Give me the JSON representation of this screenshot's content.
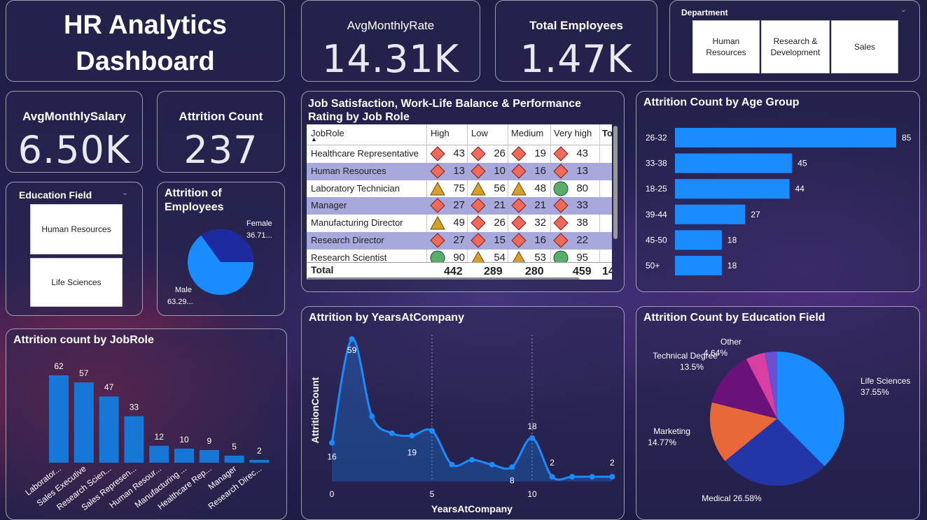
{
  "title": {
    "line1": "HR Analytics",
    "line2": "Dashboard"
  },
  "kpis": {
    "avg_monthly_rate": {
      "label": "AvgMonthlyRate",
      "value": "14.31K"
    },
    "total_employees": {
      "label": "Total Employees",
      "value": "1.47K"
    },
    "avg_monthly_salary": {
      "label": "AvgMonthlySalary",
      "value": "6.50K"
    },
    "attrition_count": {
      "label": "Attrition Count",
      "value": "237"
    }
  },
  "department_slicer": {
    "label": "Department",
    "options": [
      "Human Resources",
      "Research & Development",
      "Sales"
    ]
  },
  "education_slicer": {
    "label": "Education Field",
    "options": [
      "Human Resources",
      "Life Sciences"
    ]
  },
  "gender_pie": {
    "title": "Attrition of Employees",
    "female_label": "Female",
    "female_value": "36.71...",
    "male_label": "Male",
    "male_value": "63.29..."
  },
  "job_table": {
    "title": "Job Satisfaction, Work-Life Balance & Performance Rating by Job Role",
    "columns": [
      "JobRole",
      "High",
      "Low",
      "Medium",
      "Very high",
      "To"
    ],
    "rows": [
      {
        "role": "Healthcare Representative",
        "values": [
          "43",
          "26",
          "19",
          "43"
        ],
        "icons": [
          "diamond",
          "diamond",
          "diamond",
          "diamond"
        ]
      },
      {
        "role": "Human Resources",
        "values": [
          "13",
          "10",
          "16",
          "13"
        ],
        "icons": [
          "diamond",
          "diamond",
          "diamond",
          "diamond"
        ]
      },
      {
        "role": "Laboratory Technician",
        "values": [
          "75",
          "56",
          "48",
          "80"
        ],
        "icons": [
          "triangle",
          "triangle",
          "triangle",
          "circle"
        ]
      },
      {
        "role": "Manager",
        "values": [
          "27",
          "21",
          "21",
          "33"
        ],
        "icons": [
          "diamond",
          "diamond",
          "diamond",
          "diamond"
        ]
      },
      {
        "role": "Manufacturing Director",
        "values": [
          "49",
          "26",
          "32",
          "38"
        ],
        "icons": [
          "triangle",
          "diamond",
          "diamond",
          "diamond"
        ]
      },
      {
        "role": "Research Director",
        "values": [
          "27",
          "15",
          "16",
          "22"
        ],
        "icons": [
          "diamond",
          "diamond",
          "diamond",
          "diamond"
        ]
      },
      {
        "role": "Research Scientist",
        "values": [
          "90",
          "54",
          "53",
          "95"
        ],
        "icons": [
          "circle",
          "triangle",
          "triangle",
          "circle"
        ]
      }
    ],
    "total": {
      "label": "Total",
      "values": [
        "442",
        "289",
        "280",
        "459",
        "14"
      ]
    },
    "colors": {
      "diamond": "#ef6a5a",
      "triangle": "#d4a02a",
      "circle": "#5aac6a"
    }
  },
  "age_chart": {
    "title": "Attrition Count by Age Group",
    "chart_data": {
      "type": "bar",
      "orientation": "horizontal",
      "categories": [
        "26-32",
        "33-38",
        "18-25",
        "39-44",
        "45-50",
        "50+"
      ],
      "values": [
        85,
        45,
        44,
        27,
        18,
        18
      ],
      "color": "#1a8cff"
    }
  },
  "jobrole_chart": {
    "title": "Attrition count by JobRole",
    "chart_data": {
      "type": "bar",
      "categories": [
        "Laborator...",
        "Sales Executive",
        "Research Scien...",
        "Sales Represen...",
        "Human Resour...",
        "Manufacturing ...",
        "Healthcare Rep...",
        "Manager",
        "Research Direc..."
      ],
      "values": [
        62,
        57,
        47,
        33,
        12,
        10,
        9,
        5,
        2
      ],
      "color": "#1777d6"
    }
  },
  "years_chart": {
    "title": "Attrition by YearsAtCompany",
    "xlabel": "YearsAtCompany",
    "ylabel": "AttritionCount",
    "chart_data": {
      "type": "area",
      "x": [
        0,
        1,
        2,
        3,
        4,
        5,
        6,
        7,
        8,
        9,
        10,
        11,
        12,
        13,
        14
      ],
      "values": [
        16,
        59,
        27,
        20,
        19,
        21,
        7,
        9,
        7,
        6,
        18,
        2,
        2,
        2,
        2
      ],
      "labeled": {
        "0": "16",
        "1": "59",
        "4": "19",
        "9": "8",
        "10": "18",
        "11": "2",
        "14": "2"
      },
      "xticks": [
        "0",
        "5",
        "10"
      ],
      "color": "#1a8cff"
    }
  },
  "education_chart": {
    "title": "Attrition Count by Education Field",
    "chart_data": {
      "type": "pie",
      "slices": [
        {
          "name": "Life Sciences",
          "pct": "37.55%",
          "value": 37.55,
          "color": "#1a8cff"
        },
        {
          "name": "Medical",
          "pct": "26.58%",
          "value": 26.58,
          "color": "#2236a8"
        },
        {
          "name": "Marketing",
          "pct": "14.77%",
          "value": 14.77,
          "color": "#e8683a"
        },
        {
          "name": "Technical Degree",
          "pct": "13.5%",
          "value": 13.5,
          "color": "#6a127a"
        },
        {
          "name": "Other",
          "pct": "4.64%",
          "value": 4.64,
          "color": "#d93fa3"
        },
        {
          "name": "",
          "pct": "",
          "value": 2.96,
          "color": "#6a4fd1"
        }
      ]
    }
  }
}
